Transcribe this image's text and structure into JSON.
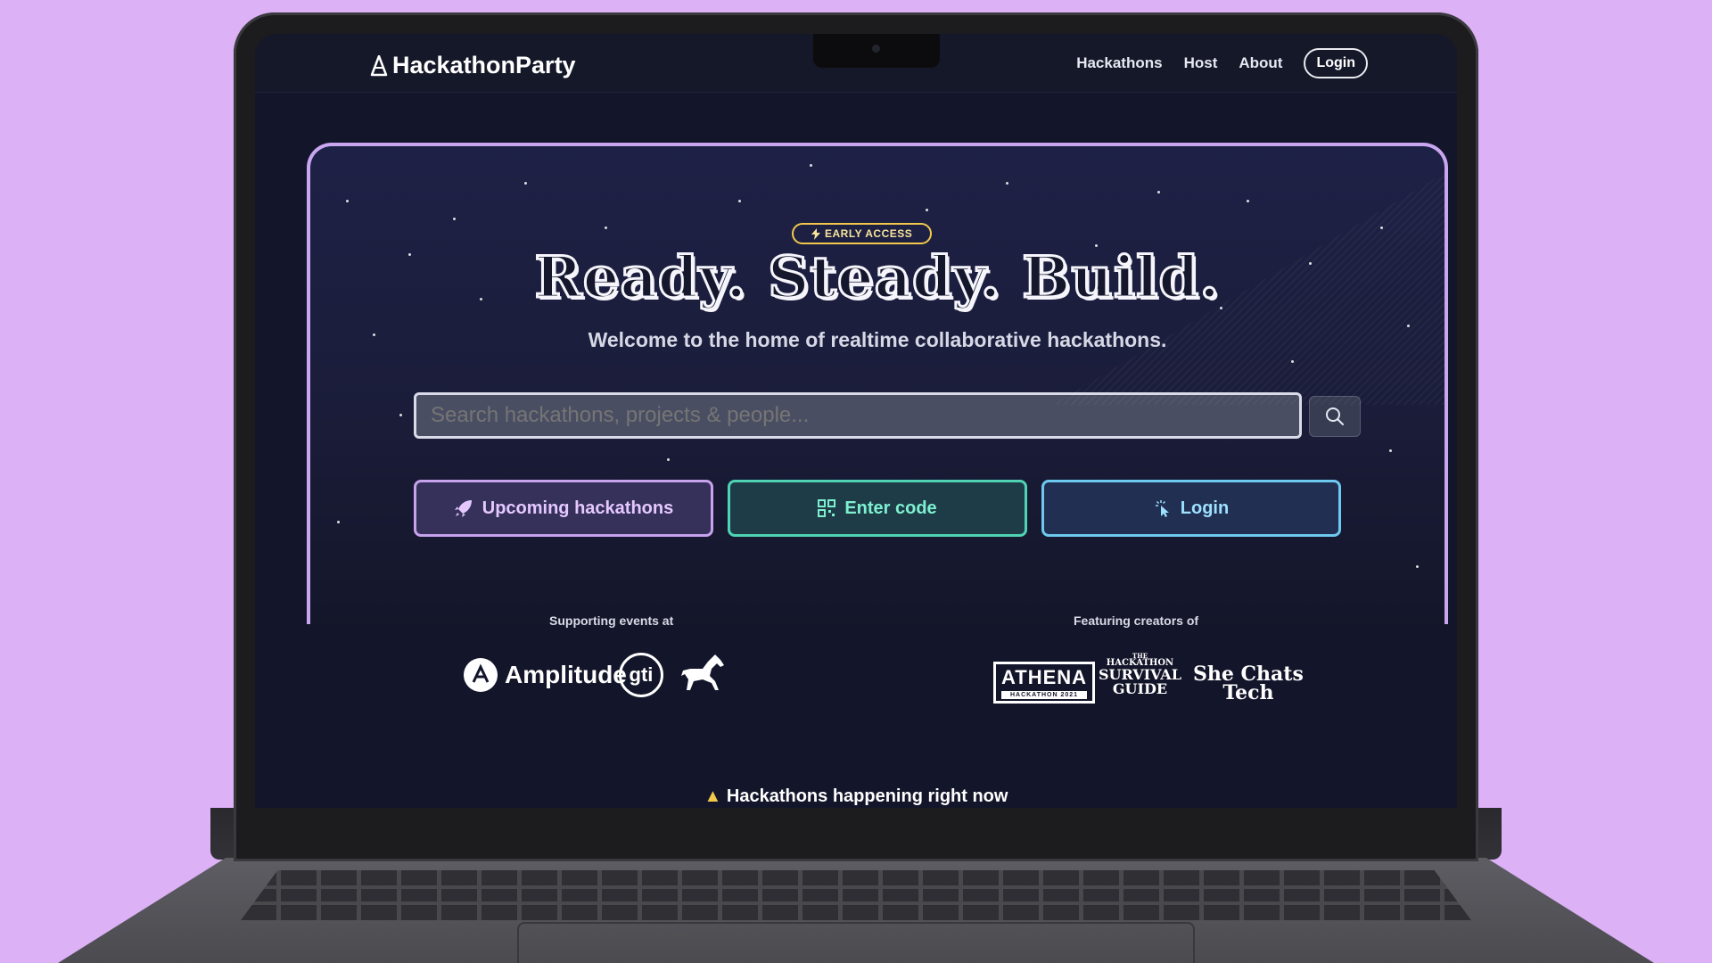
{
  "nav": {
    "brand": "HackathonParty",
    "links": [
      "Hackathons",
      "Host",
      "About"
    ],
    "login": "Login"
  },
  "hero": {
    "badge": "EARLY ACCESS",
    "headline": "Ready. Steady. Build.",
    "subhead": "Welcome to the home of realtime collaborative hackathons.",
    "search_placeholder": "Search hackathons, projects & people...",
    "buttons": {
      "upcoming": "Upcoming hackathons",
      "enter_code": "Enter code",
      "login": "Login"
    }
  },
  "supporting": {
    "label": "Supporting events at",
    "amplitude": "Amplitude",
    "gti": "gti"
  },
  "featuring": {
    "label": "Featuring creators of",
    "athena": "ATHENA",
    "athena_sub": "HACKATHON 2021",
    "survival_top": "THE",
    "survival_1": "HACKATHON",
    "survival_2": "SURVIVAL",
    "survival_3": "GUIDE",
    "shechats_1": "She Chats",
    "shechats_2": "Tech"
  },
  "happening": "Hackathons happening right now",
  "colors": {
    "page_bg": "#dcb1f6",
    "screen_bg": "#13152a",
    "accent_purple": "#c7a3ee",
    "accent_teal": "#4fd3b4",
    "accent_blue": "#6dc9ef",
    "badge_yellow": "#f2c84b"
  }
}
